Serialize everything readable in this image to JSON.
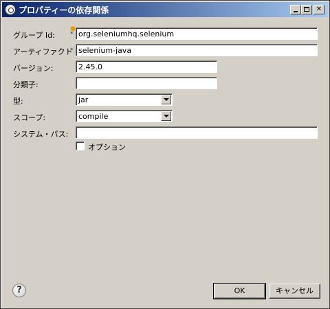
{
  "window": {
    "title": "プロパティーの依存関係"
  },
  "icons": {
    "title": "settings-gear-icon",
    "help": "help-icon",
    "required": "asterisk-icon",
    "warning": "lightbulb-warning-icon"
  },
  "form": {
    "group_id": {
      "label": "グループ Id:",
      "value": "org.seleniumhq.selenium"
    },
    "artifact_id": {
      "label": "アーティファクト Id:",
      "value": "selenium-java"
    },
    "version": {
      "label": "バージョン:",
      "value": "2.45.0"
    },
    "classifier": {
      "label": "分類子:",
      "value": ""
    },
    "type": {
      "label": "型:",
      "value": "jar"
    },
    "scope": {
      "label": "スコープ:",
      "value": "compile"
    },
    "system_path": {
      "label": "システム・パス:",
      "value": ""
    },
    "optional": {
      "label": "オプション",
      "checked": false
    }
  },
  "buttons": {
    "ok": "OK",
    "cancel": "キャンセル",
    "help": "?"
  },
  "colors": {
    "title_start": "#0a246a",
    "title_end": "#a6caf0",
    "face": "#d4d0c8"
  }
}
